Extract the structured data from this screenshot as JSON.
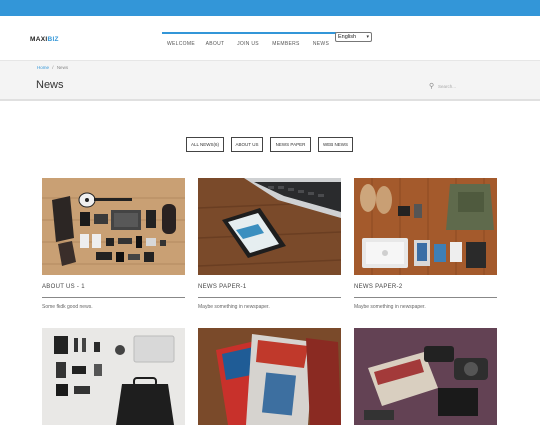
{
  "brand": {
    "logo_part1": "MAXI",
    "logo_part2": "BIZ",
    "accent": "#3396d8"
  },
  "nav": {
    "items": [
      "WELCOME",
      "ABOUT",
      "JOIN US",
      "MEMBERS",
      "NEWS"
    ],
    "language": "English"
  },
  "breadcrumb": {
    "home": "Home",
    "separator": "/",
    "current": "News"
  },
  "page": {
    "title": "News"
  },
  "search": {
    "placeholder": "Search..."
  },
  "filters": [
    "ALL NEWS(6)",
    "ABOUT US",
    "NEWS PAPER",
    "WEB NEWS"
  ],
  "cards": [
    {
      "title": "ABOUT US - 1",
      "desc": "Some fkdk good news."
    },
    {
      "title": "NEWS PAPER-1",
      "desc": "Maybe something in newspaper."
    },
    {
      "title": "NEWS PAPER-2",
      "desc": "Maybe something in newspaper."
    },
    {
      "title": "",
      "desc": ""
    },
    {
      "title": "",
      "desc": ""
    },
    {
      "title": "",
      "desc": ""
    }
  ]
}
